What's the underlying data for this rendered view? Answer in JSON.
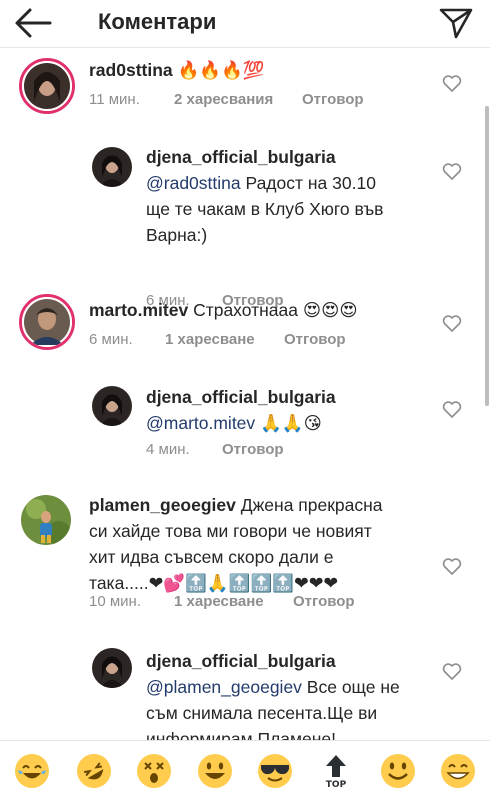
{
  "header": {
    "title": "Коментари",
    "back_icon": "arrow-left-icon",
    "send_icon": "paper-plane-icon"
  },
  "comments": [
    {
      "username": "rad0sttina",
      "text": "",
      "emojis": "🔥🔥🔥💯",
      "time": "11 мин.",
      "likes": "2 харесвания",
      "reply": "Отговор"
    },
    {
      "username": "djena_official_bulgaria",
      "mention": "@rad0sttina",
      "text_line1": " Радост на 30.10",
      "text_line2": "ще те чакам в Клуб Хюго във",
      "text_line3": "Варна:)",
      "time": "6 мин.",
      "reply": "Отговор"
    },
    {
      "username": "marto.mitev",
      "text": " Страхотнааа",
      "emojis": "😍😍😍",
      "time": "6 мин.",
      "likes": "1 харесване",
      "reply": "Отговор"
    },
    {
      "username": "djena_official_bulgaria",
      "mention": "@marto.mitev",
      "emojis": "🙏🙏😘",
      "time": "4 мин.",
      "reply": "Отговор"
    },
    {
      "username": "plamen_geoegiev",
      "text_line1": " Джена прекрасна",
      "text_line2": "си хайде това ми говори че новият",
      "text_line3": "хит идва съвсем скоро дали е",
      "text_line4": "така.....",
      "emojis": "❤💕🔝🙏🔝🔝🔝❤❤❤",
      "time": "10 мин.",
      "likes": "1 харесване",
      "reply": "Отговор"
    },
    {
      "username": "djena_official_bulgaria",
      "mention": "@plamen_geoegiev",
      "text_line1": " Все още не",
      "text_line2": "съм снимала песента.Ще ви",
      "text_line3": "информирам Пламене!"
    }
  ],
  "emoji_bar": [
    "😂",
    "🤣",
    "😵",
    "😀",
    "😎",
    "🔝",
    "😀",
    "😁"
  ],
  "colors": {
    "story_ring": "#e1306c",
    "mention": "#233c6c",
    "meta": "#8e8e8e"
  }
}
